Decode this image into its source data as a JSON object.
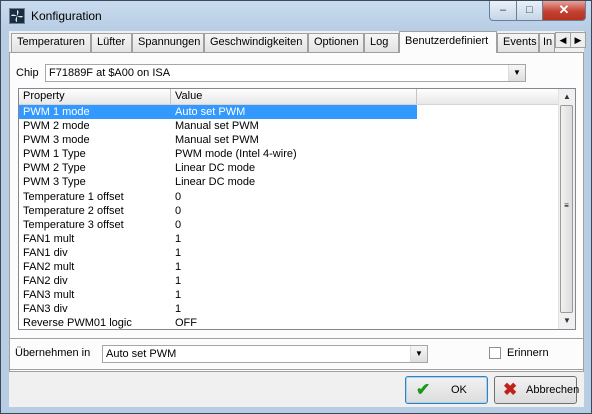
{
  "window": {
    "title": "Konfiguration"
  },
  "tabs": [
    {
      "label": "Temperaturen"
    },
    {
      "label": "Lüfter"
    },
    {
      "label": "Spannungen"
    },
    {
      "label": "Geschwindigkeiten"
    },
    {
      "label": "Optionen"
    },
    {
      "label": "Log"
    },
    {
      "label": "Benutzerdefiniert"
    },
    {
      "label": "Events"
    },
    {
      "label": "In"
    }
  ],
  "chip": {
    "label": "Chip",
    "value": "F71889F at $A00 on ISA"
  },
  "grid": {
    "columns": [
      "Property",
      "Value"
    ],
    "rows": [
      {
        "property": "PWM 1 mode",
        "value": "Auto set PWM"
      },
      {
        "property": "PWM 2 mode",
        "value": "Manual set PWM"
      },
      {
        "property": "PWM 3 mode",
        "value": "Manual set PWM"
      },
      {
        "property": "PWM 1 Type",
        "value": "PWM mode (Intel 4-wire)"
      },
      {
        "property": "PWM 2 Type",
        "value": "Linear DC mode"
      },
      {
        "property": "PWM 3 Type",
        "value": "Linear DC mode"
      },
      {
        "property": "Temperature 1 offset",
        "value": "0"
      },
      {
        "property": "Temperature 2 offset",
        "value": "0"
      },
      {
        "property": "Temperature 3 offset",
        "value": "0"
      },
      {
        "property": "FAN1 mult",
        "value": "1"
      },
      {
        "property": "FAN1 div",
        "value": "1"
      },
      {
        "property": "FAN2 mult",
        "value": "1"
      },
      {
        "property": "FAN2 div",
        "value": "1"
      },
      {
        "property": "FAN3 mult",
        "value": "1"
      },
      {
        "property": "FAN3 div",
        "value": "1"
      },
      {
        "property": "Reverse PWM01 logic",
        "value": "OFF"
      }
    ],
    "selected_row": "PWM 1 mode"
  },
  "apply": {
    "label": "Übernehmen in",
    "value": "Auto set PWM",
    "remember_label": "Erinnern",
    "remember_checked": false
  },
  "buttons": {
    "ok": "OK",
    "cancel": "Abbrechen"
  },
  "colors": {
    "selection": "#3399ff",
    "ok_icon": "#1a9a1a",
    "cancel_icon": "#c0221b"
  }
}
